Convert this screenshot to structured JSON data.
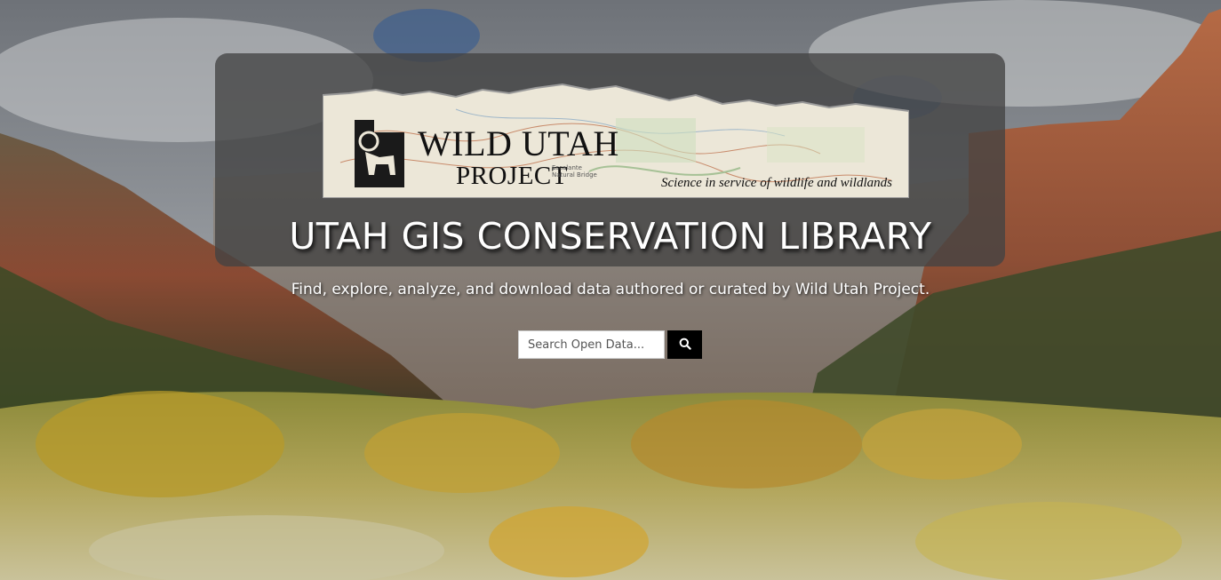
{
  "logo": {
    "line1": "WILD UTAH",
    "line2": "PROJECT",
    "tagline": "Science in service of wildlife and wildlands",
    "map_labels": "Escalante Natural Bridge"
  },
  "hero": {
    "title": "UTAH GIS CONSERVATION LIBRARY",
    "subtitle": "Find, explore, analyze, and download data authored or curated by Wild Utah Project."
  },
  "search": {
    "placeholder": "Search Open Data...",
    "button_icon": "search-icon"
  },
  "colors": {
    "panel": "#424242",
    "search_button": "#000000",
    "title_text": "#ffffff"
  }
}
